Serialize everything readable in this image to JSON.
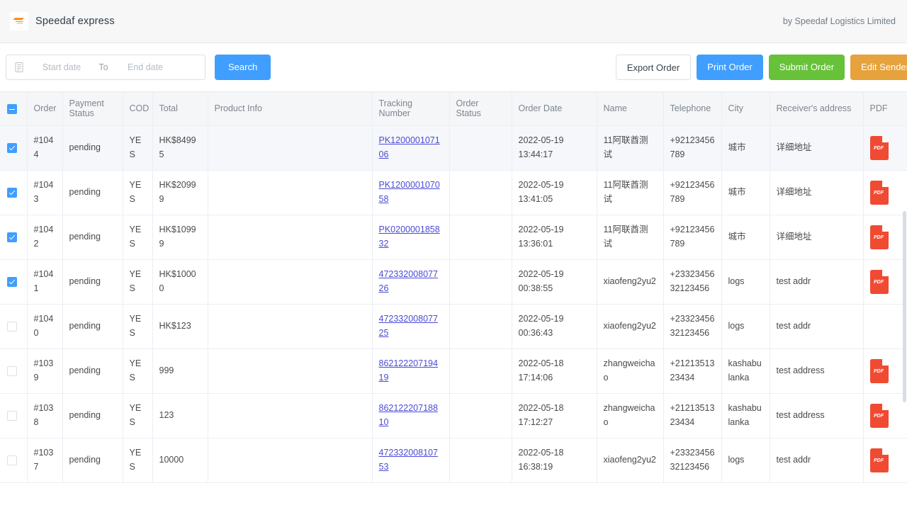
{
  "header": {
    "brand_name": "Speedaf express",
    "logo_icon": "speedaf-arrow-logo",
    "credit": "by Speedaf Logistics Limited"
  },
  "toolbar": {
    "calendar_icon": "calendar-icon",
    "start_date_placeholder": "Start date",
    "start_date_value": "",
    "to_separator": "To",
    "end_date_placeholder": "End date",
    "end_date_value": "",
    "search_label": "Search",
    "export_label": "Export Order",
    "print_label": "Print Order",
    "submit_label": "Submit Order",
    "edit_sender_label": "Edit Sender"
  },
  "colors": {
    "primary_blue": "#409eff",
    "success_green": "#67c23a",
    "warning_orange": "#e6a23c",
    "link_purple": "#4b4bd6",
    "pdf_red": "#f04a33",
    "header_bg": "#f5f6f8"
  },
  "table": {
    "select_all_state": "indeterminate",
    "columns": [
      "",
      "Order",
      "Payment Status",
      "COD",
      "Total",
      "Product Info",
      "Tracking Number",
      "Order Status",
      "Order Date",
      "Name",
      "Telephone",
      "City",
      "Receiver's address",
      "PDF"
    ],
    "rows": [
      {
        "selected": true,
        "hovered": true,
        "order": "#1044",
        "payment_status": "pending",
        "cod": "YES",
        "total": "HK$84995",
        "product_info": "",
        "tracking_number": "PK120000107106",
        "order_status": "",
        "order_date": "2022-05-19 13:44:17",
        "name": "11阿联酋测试",
        "telephone": "+92123456789",
        "city": "城市",
        "address": "详细地址",
        "pdf": true
      },
      {
        "selected": true,
        "hovered": false,
        "order": "#1043",
        "payment_status": "pending",
        "cod": "YES",
        "total": "HK$20999",
        "product_info": "",
        "tracking_number": "PK120000107058",
        "order_status": "",
        "order_date": "2022-05-19 13:41:05",
        "name": "11阿联酋测试",
        "telephone": "+92123456789",
        "city": "城市",
        "address": "详细地址",
        "pdf": true
      },
      {
        "selected": true,
        "hovered": false,
        "order": "#1042",
        "payment_status": "pending",
        "cod": "YES",
        "total": "HK$10999",
        "product_info": "",
        "tracking_number": "PK020000185832",
        "order_status": "",
        "order_date": "2022-05-19 13:36:01",
        "name": "11阿联酋测试",
        "telephone": "+92123456789",
        "city": "城市",
        "address": "详细地址",
        "pdf": true
      },
      {
        "selected": true,
        "hovered": false,
        "order": "#1041",
        "payment_status": "pending",
        "cod": "YES",
        "total": "HK$10000",
        "product_info": "",
        "tracking_number": "47233200807726",
        "order_status": "",
        "order_date": "2022-05-19 00:38:55",
        "name": "xiaofeng2yu2",
        "telephone": "+2332345632123456",
        "city": "logs",
        "address": "test addr",
        "pdf": true
      },
      {
        "selected": false,
        "hovered": false,
        "order": "#1040",
        "payment_status": "pending",
        "cod": "YES",
        "total": "HK$123",
        "product_info": "",
        "tracking_number": "47233200807725",
        "order_status": "",
        "order_date": "2022-05-19 00:36:43",
        "name": "xiaofeng2yu2",
        "telephone": "+2332345632123456",
        "city": "logs",
        "address": "test addr",
        "pdf": false
      },
      {
        "selected": false,
        "hovered": false,
        "order": "#1039",
        "payment_status": "pending",
        "cod": "YES",
        "total": "999",
        "product_info": "",
        "tracking_number": "86212220719419",
        "order_status": "",
        "order_date": "2022-05-18 17:14:06",
        "name": "zhangweichao",
        "telephone": "+2121351323434",
        "city": "kashabu lanka",
        "address": "test address",
        "pdf": true
      },
      {
        "selected": false,
        "hovered": false,
        "order": "#1038",
        "payment_status": "pending",
        "cod": "YES",
        "total": "123",
        "product_info": "",
        "tracking_number": "86212220718810",
        "order_status": "",
        "order_date": "2022-05-18 17:12:27",
        "name": "zhangweichao",
        "telephone": "+2121351323434",
        "city": "kashabu lanka",
        "address": "test address",
        "pdf": true
      },
      {
        "selected": false,
        "hovered": false,
        "order": "#1037",
        "payment_status": "pending",
        "cod": "YES",
        "total": "10000",
        "product_info": "",
        "tracking_number": "47233200810753",
        "order_status": "",
        "order_date": "2022-05-18 16:38:19",
        "name": "xiaofeng2yu2",
        "telephone": "+2332345632123456",
        "city": "logs",
        "address": "test addr",
        "pdf": true
      }
    ]
  }
}
